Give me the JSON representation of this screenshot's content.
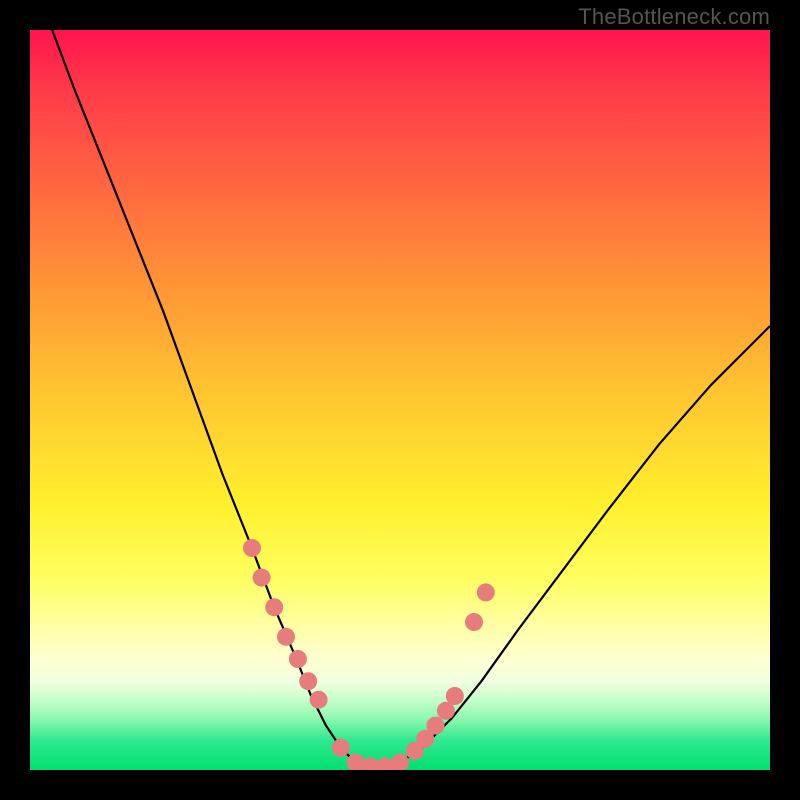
{
  "watermark": "TheBottleneck.com",
  "chart_data": {
    "type": "line",
    "title": "",
    "xlabel": "",
    "ylabel": "",
    "xlim": [
      0,
      100
    ],
    "ylim": [
      0,
      100
    ],
    "series": [
      {
        "name": "bottleneck-curve",
        "color": "#000000",
        "x": [
          3,
          6,
          10,
          14,
          18,
          22,
          26,
          30,
          33,
          36,
          38,
          40,
          42,
          44,
          46,
          48,
          50,
          53,
          57,
          61,
          66,
          72,
          78,
          85,
          92,
          100
        ],
        "y": [
          100,
          92,
          82,
          72,
          62,
          51,
          40,
          30,
          22,
          15,
          10,
          6,
          3,
          1,
          0.5,
          0.5,
          1,
          3,
          7,
          12,
          19,
          27,
          35,
          44,
          52,
          60
        ]
      }
    ],
    "markers": {
      "name": "sample-points",
      "color": "#e77c7c",
      "radius_px": 9,
      "x": [
        30.0,
        31.3,
        33.0,
        34.6,
        36.2,
        37.6,
        39.0,
        42.0,
        44.0,
        46.0,
        48.0,
        50.0,
        52.0,
        53.4,
        54.8,
        56.2,
        57.4,
        60.0,
        61.6
      ],
      "y": [
        30.0,
        26.0,
        22.0,
        18.0,
        15.0,
        12.0,
        9.5,
        3.0,
        1.0,
        0.5,
        0.5,
        1.0,
        2.6,
        4.2,
        6.0,
        8.0,
        10.0,
        20.0,
        24.0
      ]
    }
  }
}
